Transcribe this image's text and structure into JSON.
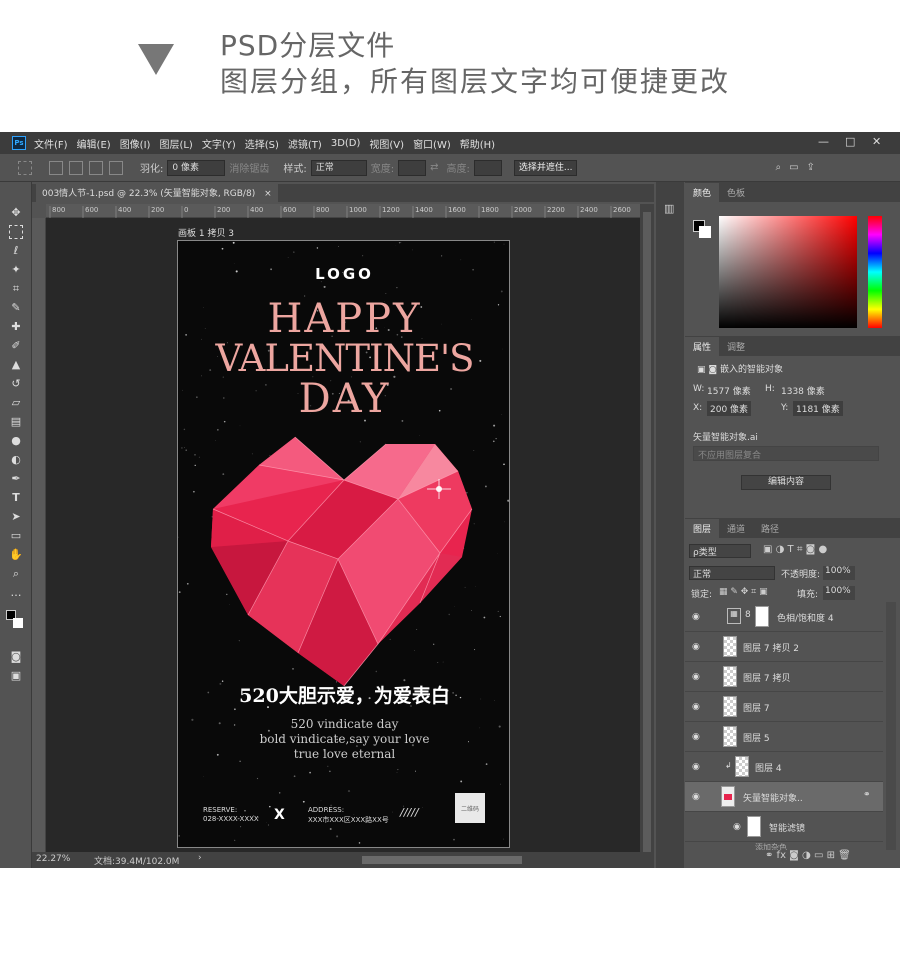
{
  "header": {
    "line1": "PSD分层文件",
    "line2": "图层分组，所有图层文字均可便捷更改"
  },
  "menubar": {
    "logo": "Ps",
    "items": [
      "文件(F)",
      "编辑(E)",
      "图像(I)",
      "图层(L)",
      "文字(Y)",
      "选择(S)",
      "滤镜(T)",
      "3D(D)",
      "视图(V)",
      "窗口(W)",
      "帮助(H)"
    ],
    "minimize": "—",
    "maximize": "□",
    "close": "✕"
  },
  "options": {
    "feather_label": "羽化:",
    "feather_value": "0 像素",
    "antialias": "消除锯齿",
    "style_label": "样式:",
    "style_value": "正常",
    "width_label": "宽度:",
    "height_label": "高度:",
    "mask_button": "选择并遮住..."
  },
  "document": {
    "tab_title": "003情人节-1.psd @ 22.3% (矢量智能对象, RGB/8)",
    "tab_close": "×",
    "artboard_label": "画板 1 拷贝 3"
  },
  "ruler": {
    "marks": [
      "800",
      "600",
      "400",
      "200",
      "0",
      "200",
      "400",
      "600",
      "800",
      "1000",
      "1200",
      "1400",
      "1600",
      "1800",
      "2000",
      "2200",
      "2400",
      "2600"
    ]
  },
  "status": {
    "zoom": "22.27%",
    "doc_info": "文档:39.4M/102.0M"
  },
  "poster": {
    "logo": "LOGO",
    "title_line1": "HAPPY",
    "title_line2": "VALENTINE'S",
    "title_line3": "DAY",
    "headline_cn": "520大胆示爱，为爱表白",
    "sub1": "520 vindicate day",
    "sub2": "bold vindicate,say your love",
    "sub3": "true love eternal",
    "reserve_label": "RESERVE:",
    "reserve_value": "028-XXXX-XXXX",
    "x_mark": "X",
    "address_label": "ADDRESS:",
    "address_value": "XXX市XXX区XXX路XX号",
    "slashes": "/////",
    "qr_label": "二维码"
  },
  "color_panel": {
    "tabs": [
      "颜色",
      "色板"
    ]
  },
  "properties": {
    "tabs": [
      "属性",
      "调整"
    ],
    "object_type": "嵌入的智能对象",
    "w_label": "W:",
    "w_value": "1577 像素",
    "h_label": "H:",
    "h_value": "1338 像素",
    "x_label": "X:",
    "x_value": "200 像素",
    "y_label": "Y:",
    "y_value": "1181 像素",
    "object_name": "矢量智能对象.ai",
    "comp_placeholder": "不应用图层复合",
    "edit_button": "编辑内容"
  },
  "layers": {
    "tabs": [
      "图层",
      "通道",
      "路径"
    ],
    "filter_value": "ρ类型",
    "blend_mode": "正常",
    "opacity_label": "不透明度:",
    "opacity_value": "100%",
    "lock_label": "锁定:",
    "fill_label": "填充:",
    "fill_value": "100%",
    "rows": [
      "色相/饱和度 4",
      "图层 7 拷贝 2",
      "图层 7 拷贝",
      "图层 7",
      "图层 5",
      "图层 4",
      "矢量智能对象..",
      "智能滤镜",
      "添加杂色"
    ]
  }
}
